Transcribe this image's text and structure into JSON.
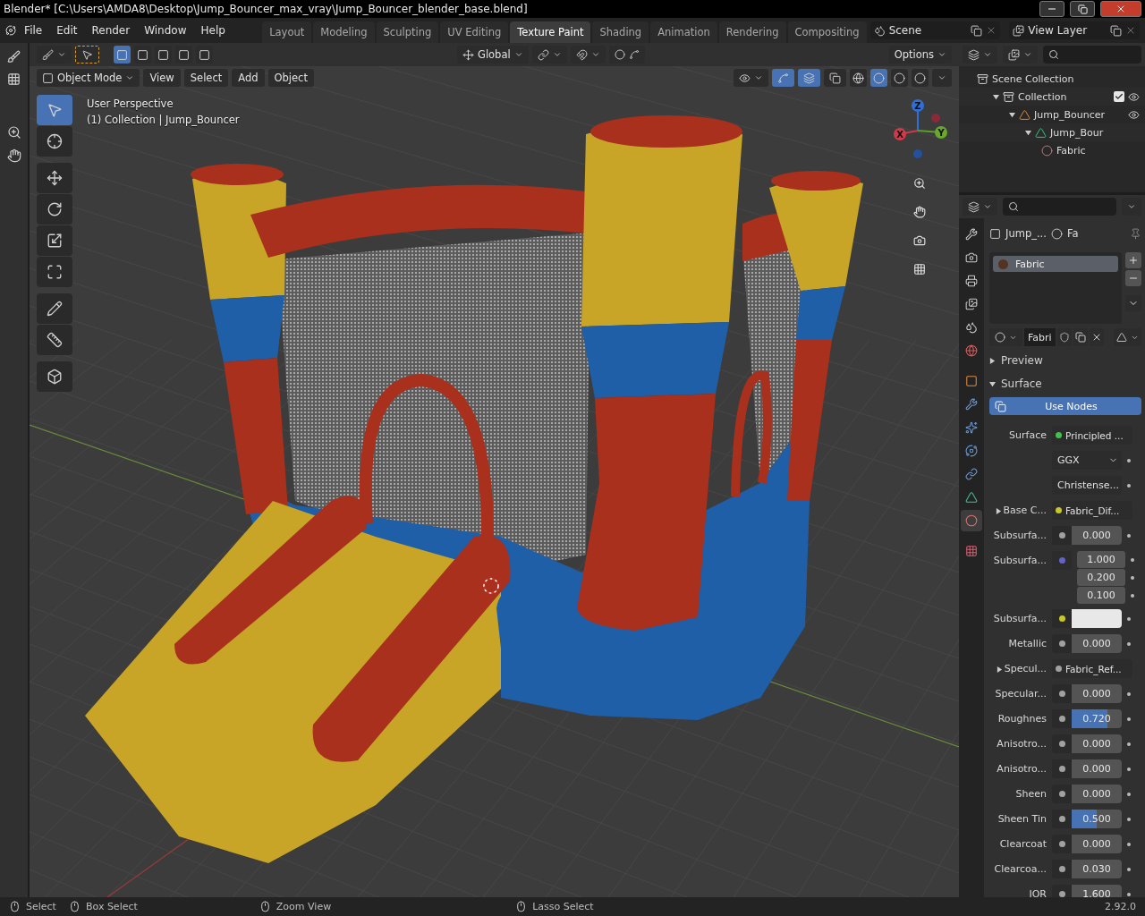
{
  "title_bar": {
    "title": "Blender* [C:\\Users\\AMDA8\\Desktop\\Jump_Bouncer_max_vray\\Jump_Bouncer_blender_base.blend]"
  },
  "menu": [
    "File",
    "Edit",
    "Render",
    "Window",
    "Help"
  ],
  "workspaces": [
    {
      "label": "Layout",
      "selected": false
    },
    {
      "label": "Modeling",
      "selected": false
    },
    {
      "label": "Sculpting",
      "selected": false
    },
    {
      "label": "UV Editing",
      "selected": false
    },
    {
      "label": "Texture Paint",
      "selected": true
    },
    {
      "label": "Shading",
      "selected": false
    },
    {
      "label": "Animation",
      "selected": false
    },
    {
      "label": "Rendering",
      "selected": false
    },
    {
      "label": "Compositing",
      "selected": false
    }
  ],
  "scene": "Scene",
  "view_layer": "View Layer",
  "tool_header": {
    "orientation": "Global",
    "options": "Options",
    "select_modes": [
      {
        "selected": true
      },
      {
        "selected": false
      },
      {
        "selected": false
      },
      {
        "selected": false
      },
      {
        "selected": false
      }
    ]
  },
  "viewport_header": {
    "mode": "Object Mode",
    "menus": [
      "View",
      "Select",
      "Add",
      "Object"
    ],
    "shading": [
      {
        "kind": "wireframe",
        "selected": false
      },
      {
        "kind": "solid",
        "selected": true
      },
      {
        "kind": "material",
        "selected": false
      },
      {
        "kind": "rendered",
        "selected": false
      }
    ]
  },
  "viewport": {
    "perspective": "User Perspective",
    "collection": "(1) Collection | Jump_Bouncer",
    "gizmo_axes": [
      "X",
      "Y",
      "Z"
    ]
  },
  "tools": [
    {
      "kind": "select",
      "selected": true
    },
    {
      "kind": "cursor",
      "selected": false
    },
    {
      "kind": "move",
      "selected": false
    },
    {
      "kind": "rotate",
      "selected": false
    },
    {
      "kind": "scale",
      "selected": false
    },
    {
      "kind": "transform",
      "selected": false
    },
    {
      "kind": "annotate",
      "selected": false
    },
    {
      "kind": "measure",
      "selected": false
    },
    {
      "kind": "add",
      "selected": false
    }
  ],
  "outliner": {
    "items": [
      {
        "label": "Scene Collection",
        "kind": "scene",
        "children": [
          {
            "label": "Collection",
            "kind": "collection",
            "expanded": true,
            "checked": true,
            "children": [
              {
                "label": "Jump_Bouncer",
                "kind": "object",
                "expanded": true,
                "children": [
                  {
                    "label": "Jump_Bour",
                    "kind": "mesh",
                    "expanded": true,
                    "children": [
                      {
                        "label": "Fabric",
                        "kind": "material"
                      }
                    ]
                  }
                ]
              }
            ]
          }
        ]
      }
    ]
  },
  "properties": {
    "tabs": [
      {
        "kind": "tool",
        "selected": false
      },
      {
        "kind": "render",
        "selected": false
      },
      {
        "kind": "output",
        "selected": false
      },
      {
        "kind": "view_layer",
        "selected": false
      },
      {
        "kind": "scene",
        "selected": false
      },
      {
        "kind": "world",
        "selected": false
      },
      {
        "kind": "object",
        "selected": false
      },
      {
        "kind": "modifiers",
        "selected": false
      },
      {
        "kind": "particles",
        "selected": false
      },
      {
        "kind": "physics",
        "selected": false
      },
      {
        "kind": "constraints",
        "selected": false
      },
      {
        "kind": "data",
        "selected": false
      },
      {
        "kind": "material",
        "selected": true
      },
      {
        "kind": "texture",
        "selected": false
      }
    ],
    "breadcrumb": [
      "Jump_...",
      "Fa"
    ],
    "material_slots": [
      {
        "label": "Fabric",
        "selected": true
      }
    ],
    "material_name": "Fabri",
    "panels": [
      {
        "label": "Preview",
        "expanded": false
      },
      {
        "label": "Surface",
        "expanded": true
      }
    ],
    "use_nodes": {
      "label": "Use Nodes",
      "on": true
    },
    "rows": [
      {
        "kind": "link",
        "label": "Surface",
        "color": "#3fc24a",
        "value": "Principled ..."
      },
      {
        "kind": "dropdown",
        "value": "GGX"
      },
      {
        "kind": "dropdown",
        "value": "Christense..."
      },
      {
        "kind": "link",
        "label": "Base C...",
        "expandable": true,
        "color": "#c7c729",
        "value": "Fabric_Dif..."
      },
      {
        "kind": "number",
        "label": "Subsurfa...",
        "color": "#a1a1a1",
        "value": "0.000"
      },
      {
        "kind": "vector",
        "label": "Subsurfa...",
        "color": "#6363c7",
        "values": [
          "1.000",
          "0.200",
          "0.100"
        ]
      },
      {
        "kind": "swatch",
        "label": "Subsurfa...",
        "color": "#c7c729"
      },
      {
        "kind": "number",
        "label": "Metallic",
        "color": "#a1a1a1",
        "value": "0.000"
      },
      {
        "kind": "link",
        "label": "Specul...",
        "expandable": true,
        "color": "#a1a1a1",
        "value": "Fabric_Ref..."
      },
      {
        "kind": "number",
        "label": "Specular...",
        "color": "#a1a1a1",
        "value": "0.000"
      },
      {
        "kind": "number",
        "label": "Roughnes",
        "color": "#a1a1a1",
        "value": "0.720",
        "level": 0.72
      },
      {
        "kind": "number",
        "label": "Anisotro...",
        "color": "#a1a1a1",
        "value": "0.000"
      },
      {
        "kind": "number",
        "label": "Anisotro...",
        "color": "#a1a1a1",
        "value": "0.000"
      },
      {
        "kind": "number",
        "label": "Sheen",
        "color": "#a1a1a1",
        "value": "0.000"
      },
      {
        "kind": "number",
        "label": "Sheen Tin",
        "color": "#a1a1a1",
        "value": "0.500",
        "level": 0.5
      },
      {
        "kind": "number",
        "label": "Clearcoat",
        "color": "#a1a1a1",
        "value": "0.000"
      },
      {
        "kind": "number",
        "label": "Clearcoa...",
        "color": "#a1a1a1",
        "value": "0.030"
      },
      {
        "kind": "number",
        "label": "IOR",
        "color": "#a1a1a1",
        "value": "1.600"
      }
    ]
  },
  "status_bar": {
    "hints": [
      "Select",
      "Box Select",
      "Zoom View",
      "Lasso Select"
    ],
    "version": "2.92.0"
  }
}
